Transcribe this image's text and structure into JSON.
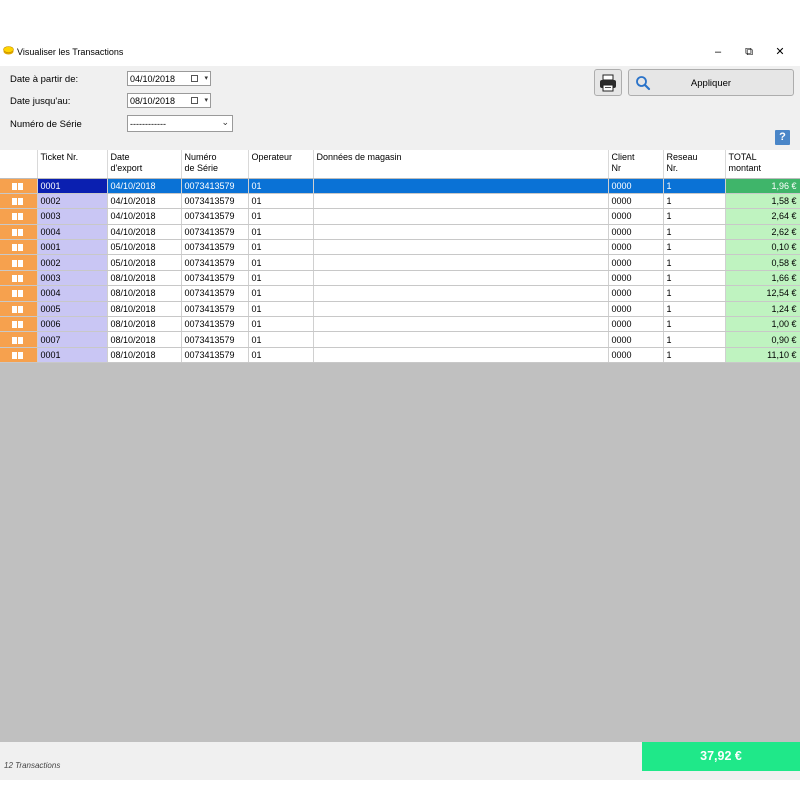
{
  "window": {
    "title": "Visualiser les Transactions",
    "controls": {
      "minimize": "–",
      "restore": "⧉",
      "close": "✕"
    }
  },
  "filters": {
    "date_from_label": "Date à partir de:",
    "date_from_value": "04/10/2018",
    "date_to_label": "Date jusqu'au:",
    "date_to_value": "08/10/2018",
    "serial_label": "Numéro de Série",
    "serial_value": "------------"
  },
  "toolbar": {
    "apply_label": "Appliquer",
    "help_label": "?"
  },
  "table": {
    "headers": {
      "ticket": "Ticket Nr.",
      "date_export": "Date\nd'export",
      "serial": "Numéro\nde Série",
      "operator": "Operateur",
      "store_data": "Données de magasin",
      "client": "Client\nNr",
      "network": "Reseau\nNr.",
      "total": "TOTAL\nmontant"
    },
    "rows": [
      {
        "ticket": "0001",
        "date": "04/10/2018",
        "serial": "0073413579",
        "operator": "01",
        "store": "",
        "client": "0000",
        "network": "1",
        "total": "1,96 €",
        "selected": true
      },
      {
        "ticket": "0002",
        "date": "04/10/2018",
        "serial": "0073413579",
        "operator": "01",
        "store": "",
        "client": "0000",
        "network": "1",
        "total": "1,58 €"
      },
      {
        "ticket": "0003",
        "date": "04/10/2018",
        "serial": "0073413579",
        "operator": "01",
        "store": "",
        "client": "0000",
        "network": "1",
        "total": "2,64 €"
      },
      {
        "ticket": "0004",
        "date": "04/10/2018",
        "serial": "0073413579",
        "operator": "01",
        "store": "",
        "client": "0000",
        "network": "1",
        "total": "2,62 €"
      },
      {
        "ticket": "0001",
        "date": "05/10/2018",
        "serial": "0073413579",
        "operator": "01",
        "store": "",
        "client": "0000",
        "network": "1",
        "total": "0,10 €"
      },
      {
        "ticket": "0002",
        "date": "05/10/2018",
        "serial": "0073413579",
        "operator": "01",
        "store": "",
        "client": "0000",
        "network": "1",
        "total": "0,58 €"
      },
      {
        "ticket": "0003",
        "date": "08/10/2018",
        "serial": "0073413579",
        "operator": "01",
        "store": "",
        "client": "0000",
        "network": "1",
        "total": "1,66 €"
      },
      {
        "ticket": "0004",
        "date": "08/10/2018",
        "serial": "0073413579",
        "operator": "01",
        "store": "",
        "client": "0000",
        "network": "1",
        "total": "12,54 €"
      },
      {
        "ticket": "0005",
        "date": "08/10/2018",
        "serial": "0073413579",
        "operator": "01",
        "store": "",
        "client": "0000",
        "network": "1",
        "total": "1,24 €"
      },
      {
        "ticket": "0006",
        "date": "08/10/2018",
        "serial": "0073413579",
        "operator": "01",
        "store": "",
        "client": "0000",
        "network": "1",
        "total": "1,00 €"
      },
      {
        "ticket": "0007",
        "date": "08/10/2018",
        "serial": "0073413579",
        "operator": "01",
        "store": "",
        "client": "0000",
        "network": "1",
        "total": "0,90 €"
      },
      {
        "ticket": "0001",
        "date": "08/10/2018",
        "serial": "0073413579",
        "operator": "01",
        "store": "",
        "client": "0000",
        "network": "1",
        "total": "11,10 €"
      }
    ]
  },
  "footer": {
    "count_text": "12 Transactions",
    "grand_total": "37,92 €"
  },
  "colors": {
    "selection": "#0a72d6",
    "ticket_cell": "#c9c6f4",
    "total_cell": "#bff3c0",
    "row_icon": "#f6a14e",
    "grand_total_bg": "#1fe889",
    "grid_background": "#c0c0c0"
  },
  "icons": {
    "app": "coins-icon",
    "calendar": "calendar-icon",
    "print": "printer-icon",
    "search": "magnifier-icon",
    "help": "help-icon",
    "row": "open-book-icon"
  }
}
